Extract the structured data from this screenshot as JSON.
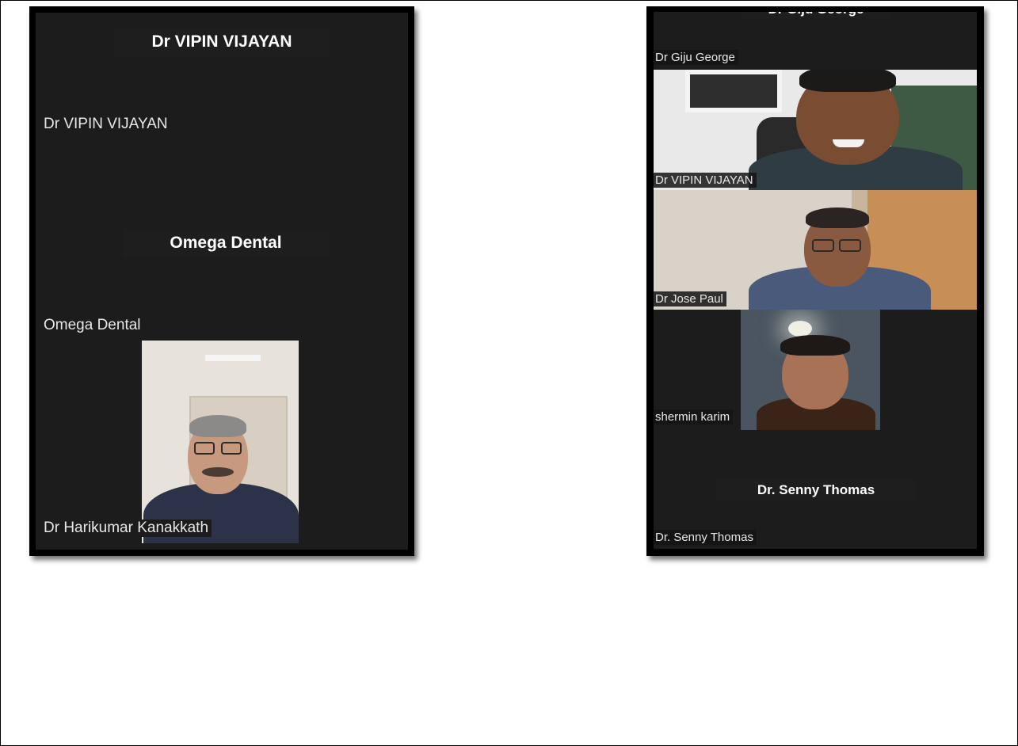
{
  "left_panel": {
    "tiles": [
      {
        "center_name": "Dr VIPIN VIJAYAN",
        "label": "Dr VIPIN VIJAYAN"
      },
      {
        "center_name": "Omega Dental",
        "label": "Omega Dental"
      },
      {
        "label": "Dr Harikumar Kanakkath"
      }
    ]
  },
  "right_panel": {
    "tiles": [
      {
        "center_name": "Dr Giju George",
        "label": "Dr Giju George"
      },
      {
        "label": "Dr VIPIN VIJAYAN"
      },
      {
        "label": "Dr Jose Paul"
      },
      {
        "label": "shermin karim"
      },
      {
        "center_name": "Dr. Senny Thomas",
        "label": "Dr. Senny Thomas"
      }
    ]
  },
  "colors": {
    "tile_background": "#1c1c1c",
    "panel_border": "#000000",
    "page_background": "#ffffff"
  }
}
